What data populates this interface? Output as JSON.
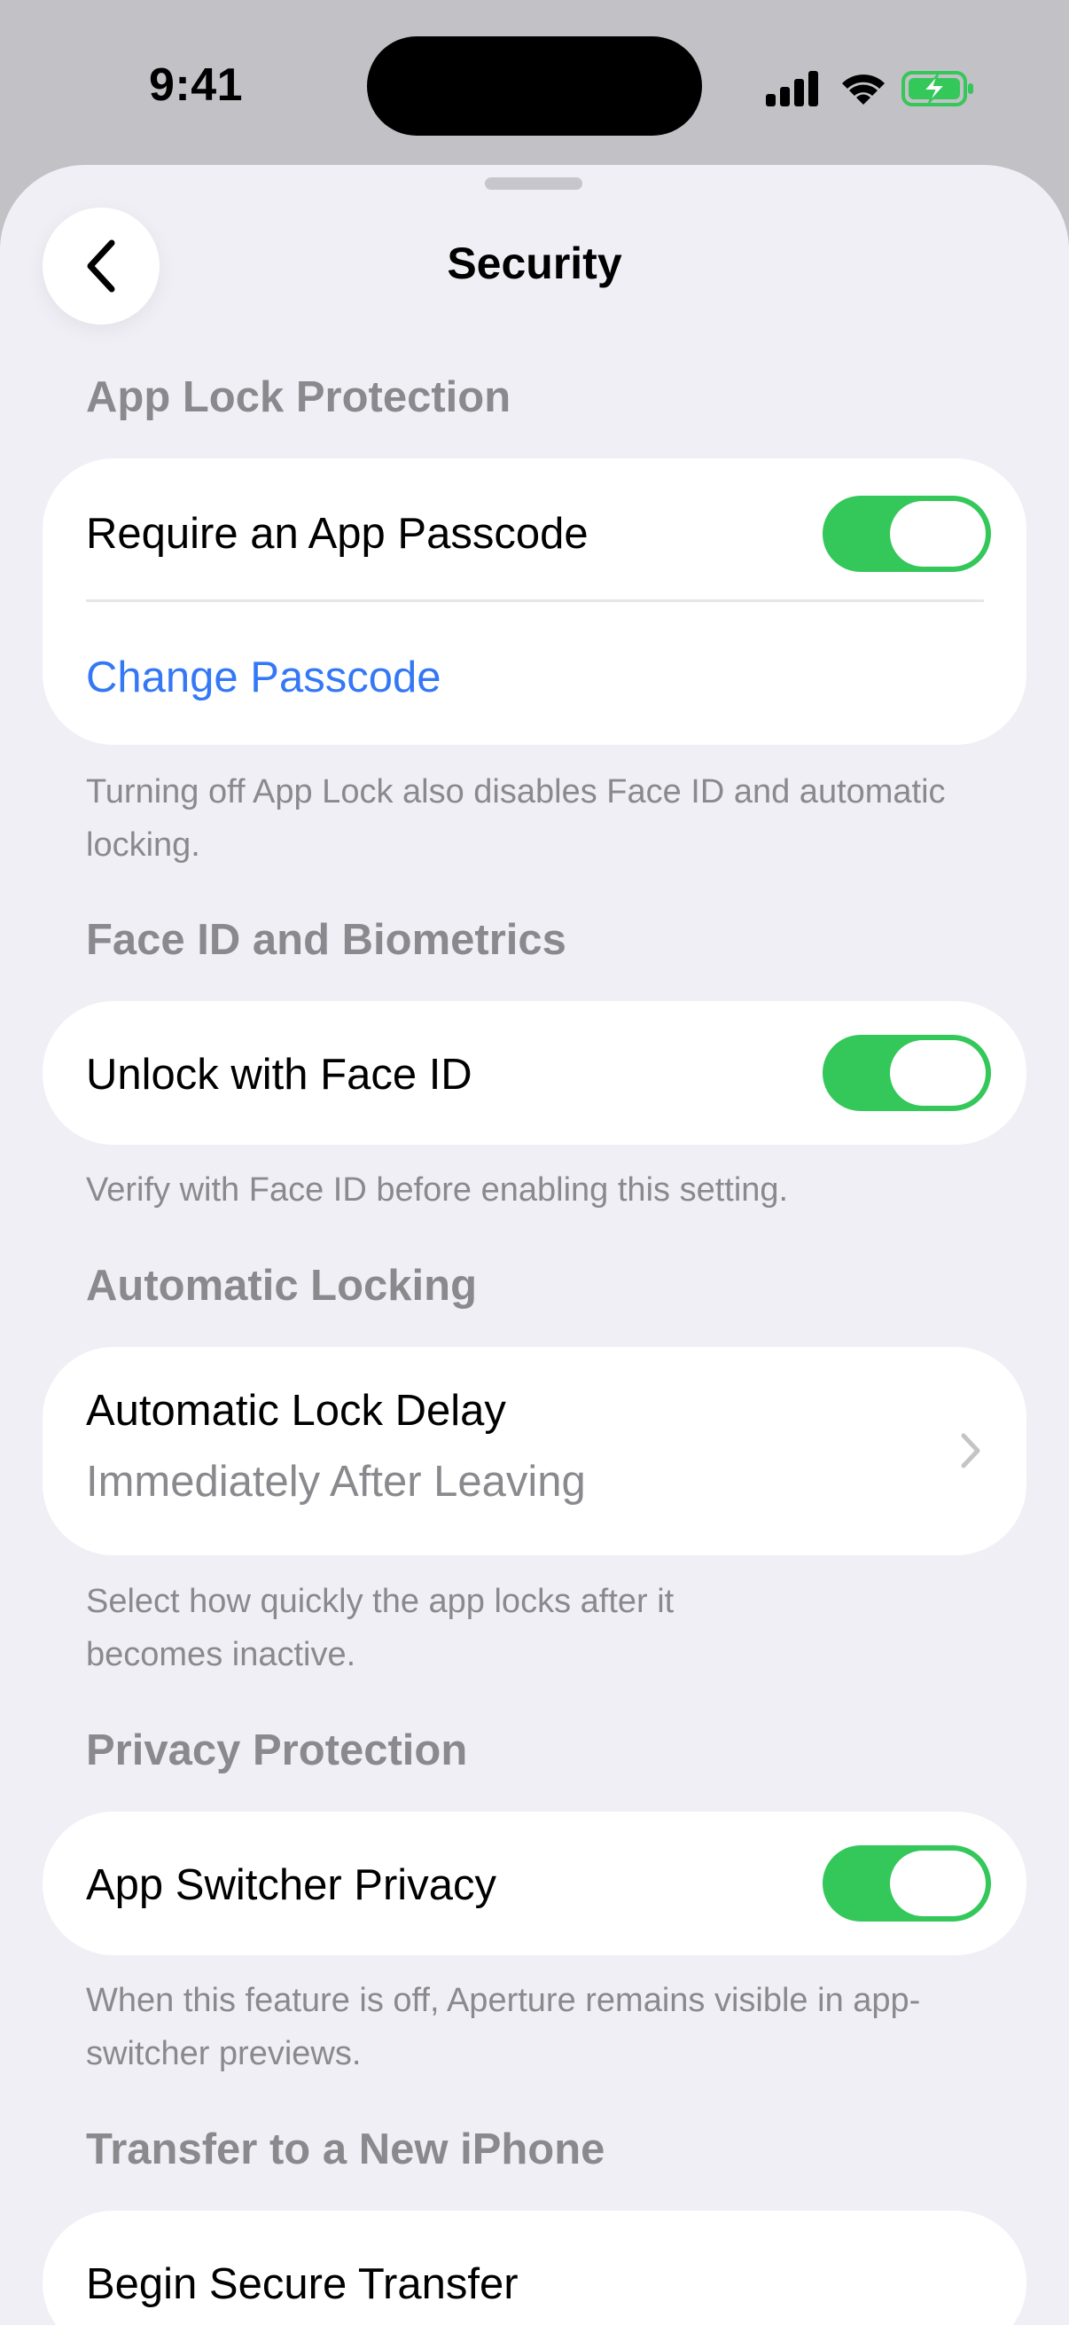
{
  "status_bar": {
    "time": "9:41"
  },
  "nav": {
    "title": "Security",
    "back_icon": "chevron-left-icon"
  },
  "sections": {
    "app_lock": {
      "header": "App Lock Protection",
      "require_passcode_label": "Require an App Passcode",
      "require_passcode_on": true,
      "change_passcode_label": "Change Passcode",
      "footer": "Turning off App Lock also disables Face ID and automatic locking."
    },
    "face_id": {
      "header": "Face ID and Biometrics",
      "unlock_label": "Unlock with Face ID",
      "unlock_on": true,
      "footer": "Verify with Face ID before enabling this setting."
    },
    "auto_lock": {
      "header": "Automatic Locking",
      "delay_label": "Automatic Lock Delay",
      "delay_value": "Immediately After Leaving",
      "footer": "Select how quickly the app locks after it becomes inactive."
    },
    "privacy": {
      "header": "Privacy Protection",
      "switcher_label": "App Switcher Privacy",
      "switcher_on": true,
      "footer": "When this feature is off, Aperture remains visible in app-switcher previews."
    },
    "transfer": {
      "header": "Transfer to a New iPhone",
      "begin_label": "Begin Secure Transfer"
    }
  },
  "colors": {
    "accent": "#3478f6",
    "toggle_on": "#34c759",
    "background": "#f0eff5",
    "secondary_text": "#8a8a8e"
  }
}
